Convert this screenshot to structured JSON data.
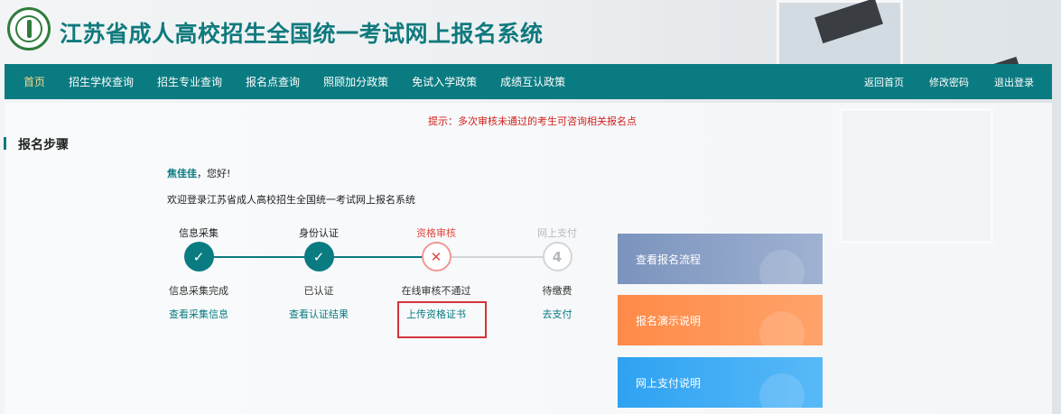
{
  "header": {
    "title": "江苏省成人高校招生全国统一考试网上报名系统"
  },
  "nav": {
    "left": [
      {
        "label": "首页",
        "active": true
      },
      {
        "label": "招生学校查询"
      },
      {
        "label": "招生专业查询"
      },
      {
        "label": "报名点查询"
      },
      {
        "label": "照顾加分政策"
      },
      {
        "label": "免试入学政策"
      },
      {
        "label": "成绩互认政策"
      }
    ],
    "right": [
      {
        "label": "返回首页"
      },
      {
        "label": "修改密码"
      },
      {
        "label": "退出登录"
      }
    ]
  },
  "tip": "提示：多次审核未通过的考生可咨询相关报名点",
  "section_title": "报名步骤",
  "greeting": {
    "name": "焦佳佳",
    "suffix": "，您好!"
  },
  "welcome": "欢迎登录江苏省成人高校招生全国统一考试网上报名系统",
  "steps": [
    {
      "label": "信息采集",
      "state": "done",
      "symbol": "✓",
      "status": "信息采集完成",
      "link": "查看采集信息"
    },
    {
      "label": "身份认证",
      "state": "done",
      "symbol": "✓",
      "status": "已认证",
      "link": "查看认证结果"
    },
    {
      "label": "资格审核",
      "state": "fail",
      "symbol": "✕",
      "status": "在线审核不通过",
      "link": "上传资格证书"
    },
    {
      "label": "网上支付",
      "state": "wait",
      "symbol": "4",
      "status": "待缴费",
      "link": "去支付"
    }
  ],
  "cards": [
    {
      "label": "查看报名流程",
      "color": "#7b93bd"
    },
    {
      "label": "报名演示说明",
      "color": "#ff8a47"
    },
    {
      "label": "网上支付说明",
      "color": "#2ea2f2"
    }
  ]
}
